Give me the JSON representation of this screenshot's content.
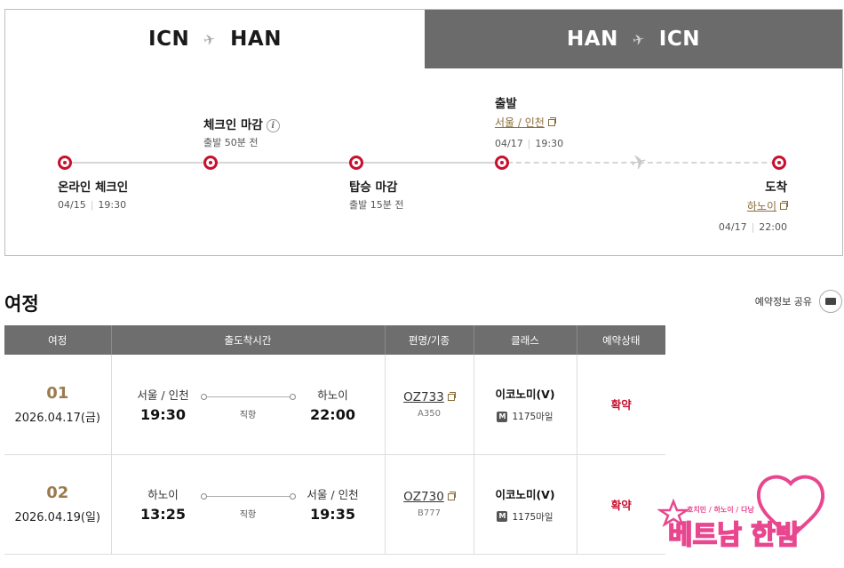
{
  "tabs": [
    {
      "from": "ICN",
      "to": "HAN",
      "active": true
    },
    {
      "from": "HAN",
      "to": "ICN",
      "active": false
    }
  ],
  "timeline": {
    "online_checkin": {
      "title": "온라인 체크인",
      "date": "04/15",
      "time": "19:30"
    },
    "checkin_close": {
      "title": "체크인 마감",
      "note": "출발 50분 전"
    },
    "boarding_close": {
      "title": "탑승 마감",
      "note": "출발 15분 전"
    },
    "departure": {
      "title": "출발",
      "place": "서울 / 인천",
      "date": "04/17",
      "time": "19:30"
    },
    "arrival": {
      "title": "도착",
      "place": "하노이",
      "date": "04/17",
      "time": "22:00"
    }
  },
  "itinerary": {
    "title": "여정",
    "share_label": "예약정보 공유",
    "columns": [
      "여정",
      "출도착시간",
      "편명/기종",
      "클래스",
      "예약상태"
    ],
    "rows": [
      {
        "seq": "01",
        "date": "2026.04.17(금)",
        "from_city": "서울 / 인천",
        "dep_time": "19:30",
        "route_type": "직항",
        "to_city": "하노이",
        "arr_time": "22:00",
        "flight": "OZ733",
        "aircraft": "A350",
        "class": "이코노미(V)",
        "miles": "1175마일",
        "status": "확약"
      },
      {
        "seq": "02",
        "date": "2026.04.19(일)",
        "from_city": "하노이",
        "dep_time": "13:25",
        "route_type": "직항",
        "to_city": "서울 / 인천",
        "arr_time": "19:35",
        "flight": "OZ730",
        "aircraft": "B777",
        "class": "이코노미(V)",
        "miles": "1175마일",
        "status": "확약"
      }
    ]
  },
  "logo": {
    "main": "베트남 한밤",
    "sub": "호치민 / 하노이 / 다낭"
  },
  "colors": {
    "accent_red": "#c8102e",
    "seq_gold": "#9c7a4f",
    "header_gray": "#6e6e6e",
    "logo_pink": "#e8478f"
  }
}
